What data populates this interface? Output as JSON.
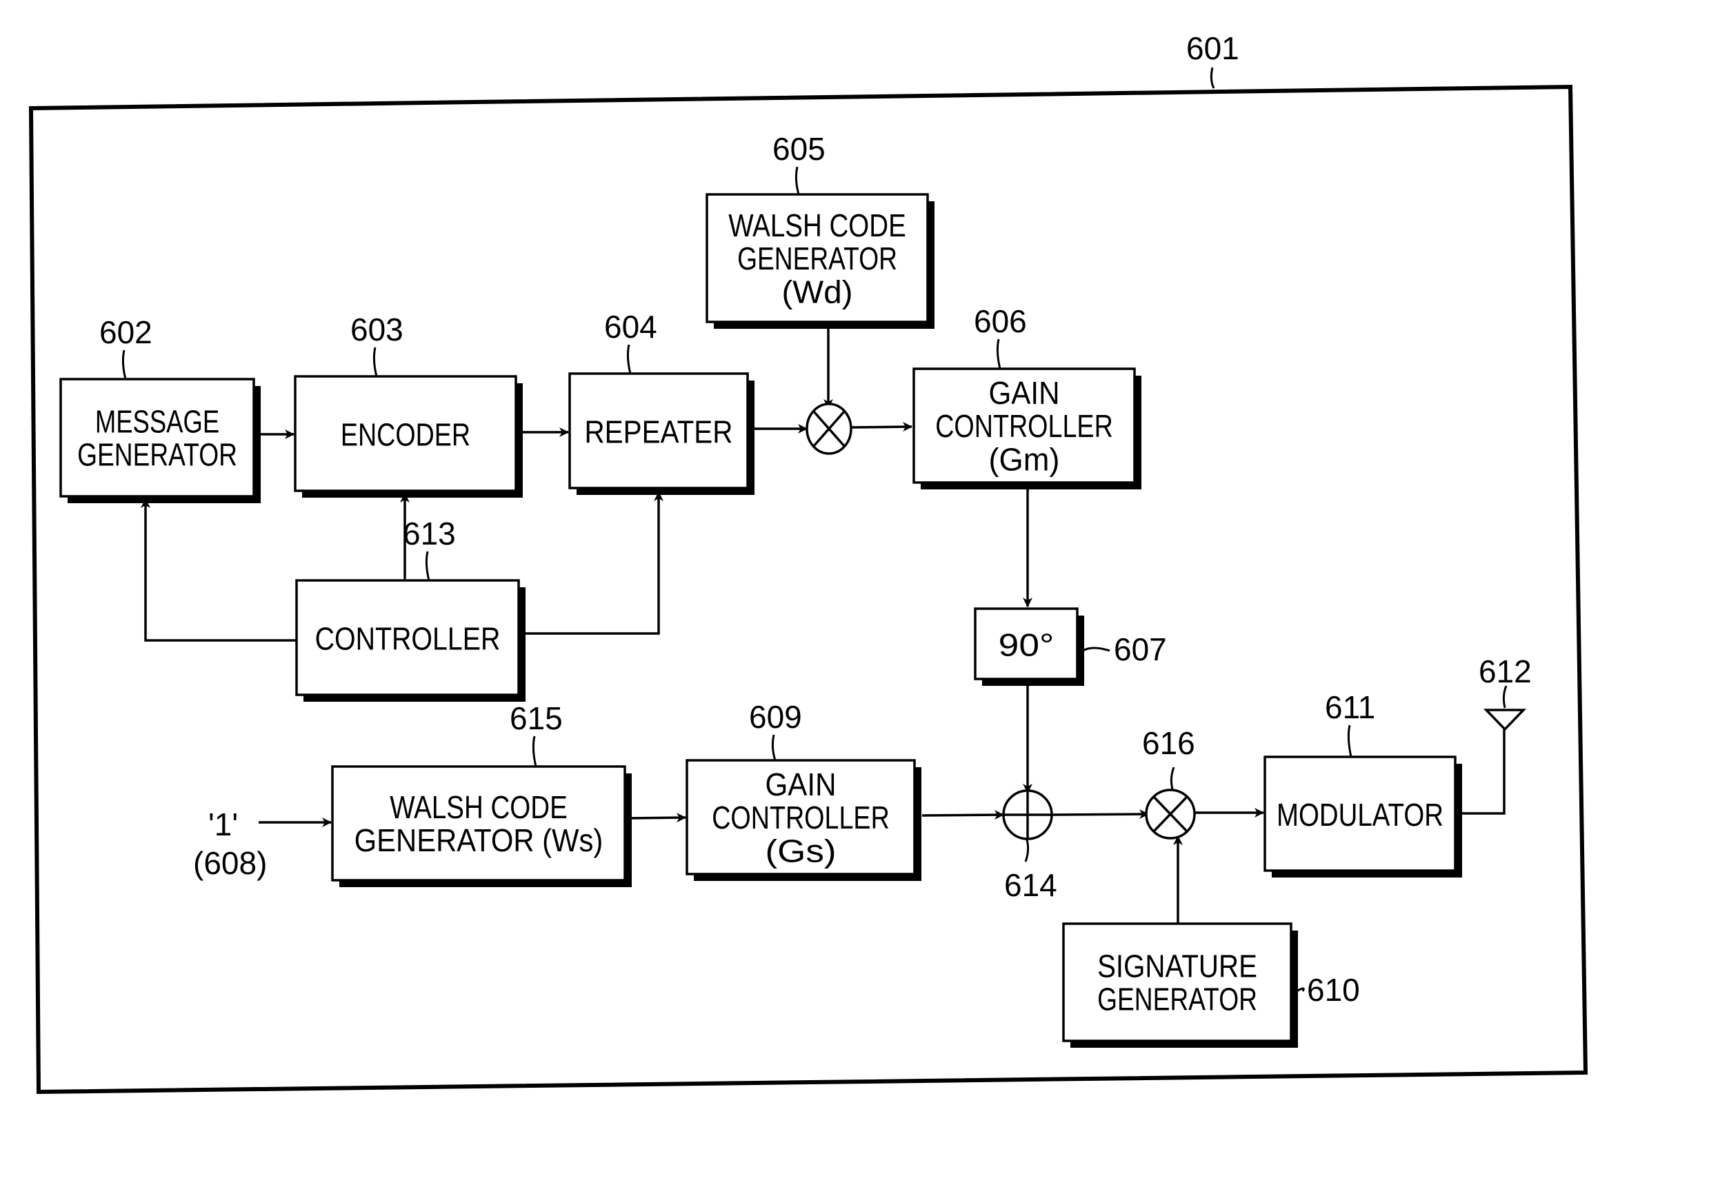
{
  "figure": {
    "container_ref": "601",
    "blocks": [
      {
        "id": "message-generator",
        "ref": "602",
        "lines": [
          "MESSAGE",
          "GENERATOR"
        ]
      },
      {
        "id": "encoder",
        "ref": "603",
        "lines": [
          "ENCODER"
        ]
      },
      {
        "id": "repeater",
        "ref": "604",
        "lines": [
          "REPEATER"
        ]
      },
      {
        "id": "walsh-code-generator-wd",
        "ref": "605",
        "lines": [
          "WALSH CODE",
          "GENERATOR",
          "(Wd)"
        ]
      },
      {
        "id": "gain-controller-gm",
        "ref": "606",
        "lines": [
          "GAIN",
          "CONTROLLER",
          "(Gm)"
        ]
      },
      {
        "id": "phase-shifter",
        "ref": "607",
        "lines": [
          "90°"
        ]
      },
      {
        "id": "gain-controller-gs",
        "ref": "609",
        "lines": [
          "GAIN",
          "CONTROLLER",
          "(Gs)"
        ]
      },
      {
        "id": "signature-generator",
        "ref": "610",
        "lines": [
          "SIGNATURE",
          "GENERATOR"
        ]
      },
      {
        "id": "modulator",
        "ref": "611",
        "lines": [
          "MODULATOR"
        ]
      },
      {
        "id": "controller",
        "ref": "613",
        "lines": [
          "CONTROLLER"
        ]
      },
      {
        "id": "walsh-code-generator-ws",
        "ref": "615",
        "lines": [
          "WALSH CODE",
          "GENERATOR (Ws)"
        ]
      }
    ],
    "nodes": [
      {
        "id": "multiplier-1",
        "symbol": "⊗"
      },
      {
        "id": "adder",
        "ref": "614",
        "symbol": "⊕"
      },
      {
        "id": "multiplier-2",
        "ref": "616",
        "symbol": "⊗"
      },
      {
        "id": "antenna",
        "ref": "612"
      }
    ],
    "input": {
      "value": "'1'",
      "ref": "(608)"
    }
  }
}
